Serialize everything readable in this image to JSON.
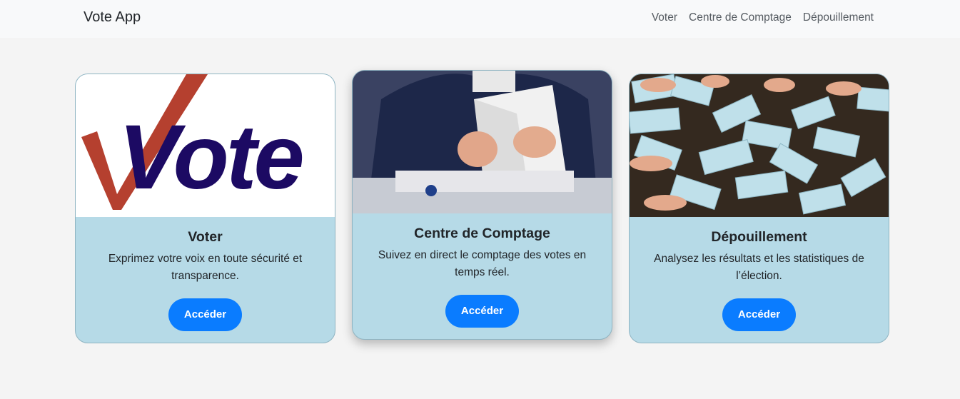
{
  "navbar": {
    "brand": "Vote App",
    "links": [
      "Voter",
      "Centre de Comptage",
      "Dépouillement"
    ]
  },
  "cards": [
    {
      "image_alt": "vote-logo",
      "title": "Voter",
      "text": "Exprimez votre voix en toute sécurité et transparence.",
      "button": "Accéder"
    },
    {
      "image_alt": "person-holding-ballots",
      "title": "Centre de Comptage",
      "text": "Suivez en direct le comptage des votes en temps réel.",
      "button": "Accéder"
    },
    {
      "image_alt": "ballot-envelopes-on-table",
      "title": "Dépouillement",
      "text": "Analysez les résultats et les statistiques de l’élection.",
      "button": "Accéder"
    }
  ],
  "logo_text": "Vote",
  "colors": {
    "navbar_bg": "#f8f9fa",
    "page_bg": "#f4f4f4",
    "card_bg": "#b6dae7",
    "button_bg": "#0a7cff",
    "logo_check": "#b5402f",
    "logo_text": "#1c0a63"
  }
}
